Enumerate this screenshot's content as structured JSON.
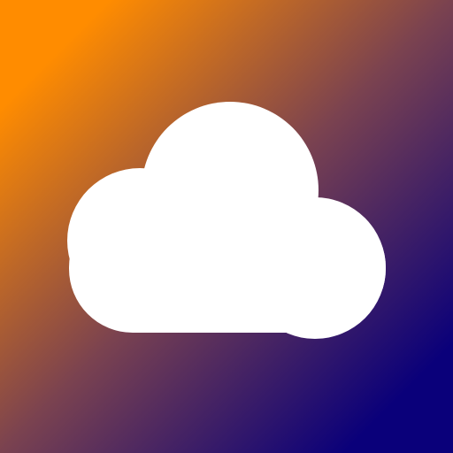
{
  "icon": {
    "name": "cloud-icon",
    "cloud_color": "#ffffff",
    "gradient": {
      "start": "#ff8c00",
      "middle": "#7a4250",
      "end": "#0a007a"
    }
  }
}
